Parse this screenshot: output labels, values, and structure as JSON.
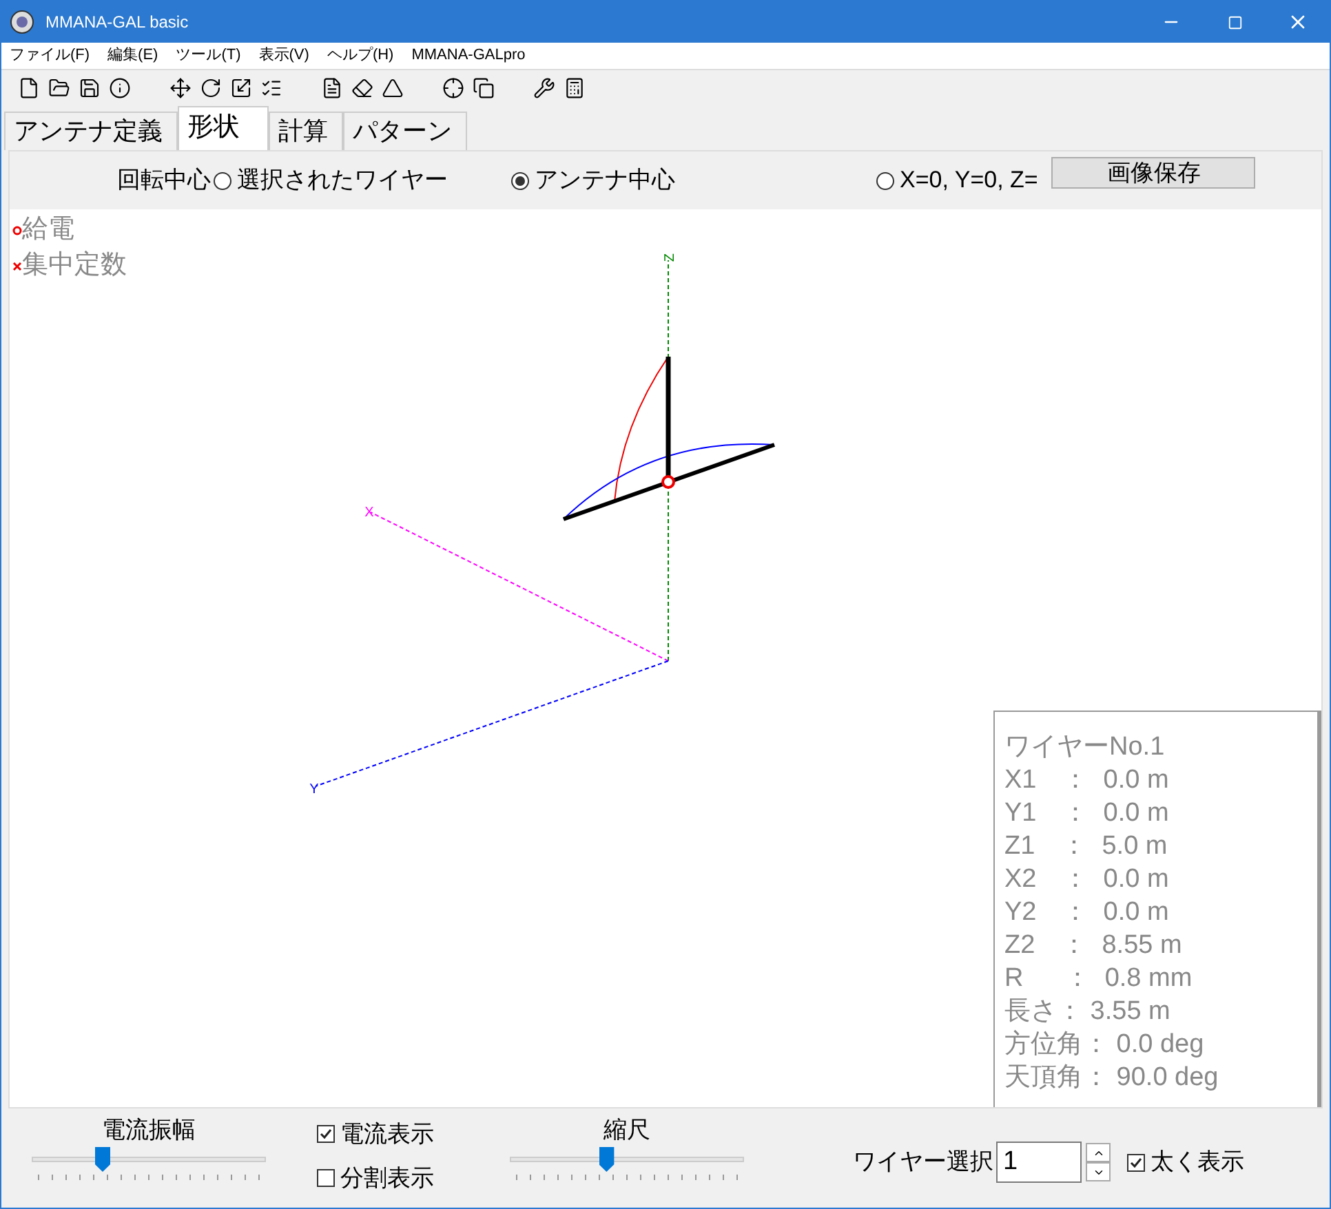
{
  "window": {
    "title": "MMANA-GAL basic"
  },
  "menu": [
    "ファイル(F)",
    "編集(E)",
    "ツール(T)",
    "表示(V)",
    "ヘルプ(H)",
    "MMANA-GALpro"
  ],
  "tabs": [
    {
      "label": "アンテナ定義",
      "selected": false
    },
    {
      "label": "形状",
      "selected": true
    },
    {
      "label": "計算",
      "selected": false
    },
    {
      "label": "パターン",
      "selected": false
    }
  ],
  "rotation_center": {
    "label": "回転中心",
    "options": [
      {
        "label": "選択されたワイヤー",
        "selected": false
      },
      {
        "label": "アンテナ中心",
        "selected": true
      },
      {
        "label": "X=0, Y=0, Z=",
        "selected": false
      }
    ]
  },
  "save_image_button": "画像保存",
  "legend": [
    {
      "kind": "feed",
      "label": "給電"
    },
    {
      "kind": "load",
      "label": "集中定数"
    }
  ],
  "axes": [
    {
      "kind": "z",
      "label": "Z"
    },
    {
      "kind": "x",
      "label": "X"
    },
    {
      "kind": "y",
      "label": "Y"
    }
  ],
  "wire_info": {
    "title": "ワイヤーNo.1",
    "lines": [
      "X1　：  0.0 m",
      "Y1　：  0.0 m",
      "Z1　：  5.0 m",
      "X2　：  0.0 m",
      "Y2　：  0.0 m",
      "Z2　：  8.55 m",
      "R　  ：  0.8 mm",
      "長さ： 3.55 m",
      "方位角： 0.0 deg",
      "天頂角： 90.0 deg"
    ]
  },
  "current_amplitude": {
    "label": "電流振幅",
    "level": 0.3
  },
  "current_display": {
    "label": "電流表示",
    "checked": true
  },
  "segment_display": {
    "label": "分割表示",
    "checked": false
  },
  "scale": {
    "label": "縮尺",
    "level": 0.41
  },
  "wire_select": {
    "label": "ワイヤー選択",
    "value": "1"
  },
  "bold_display": {
    "label": "太く表示",
    "checked": true
  }
}
